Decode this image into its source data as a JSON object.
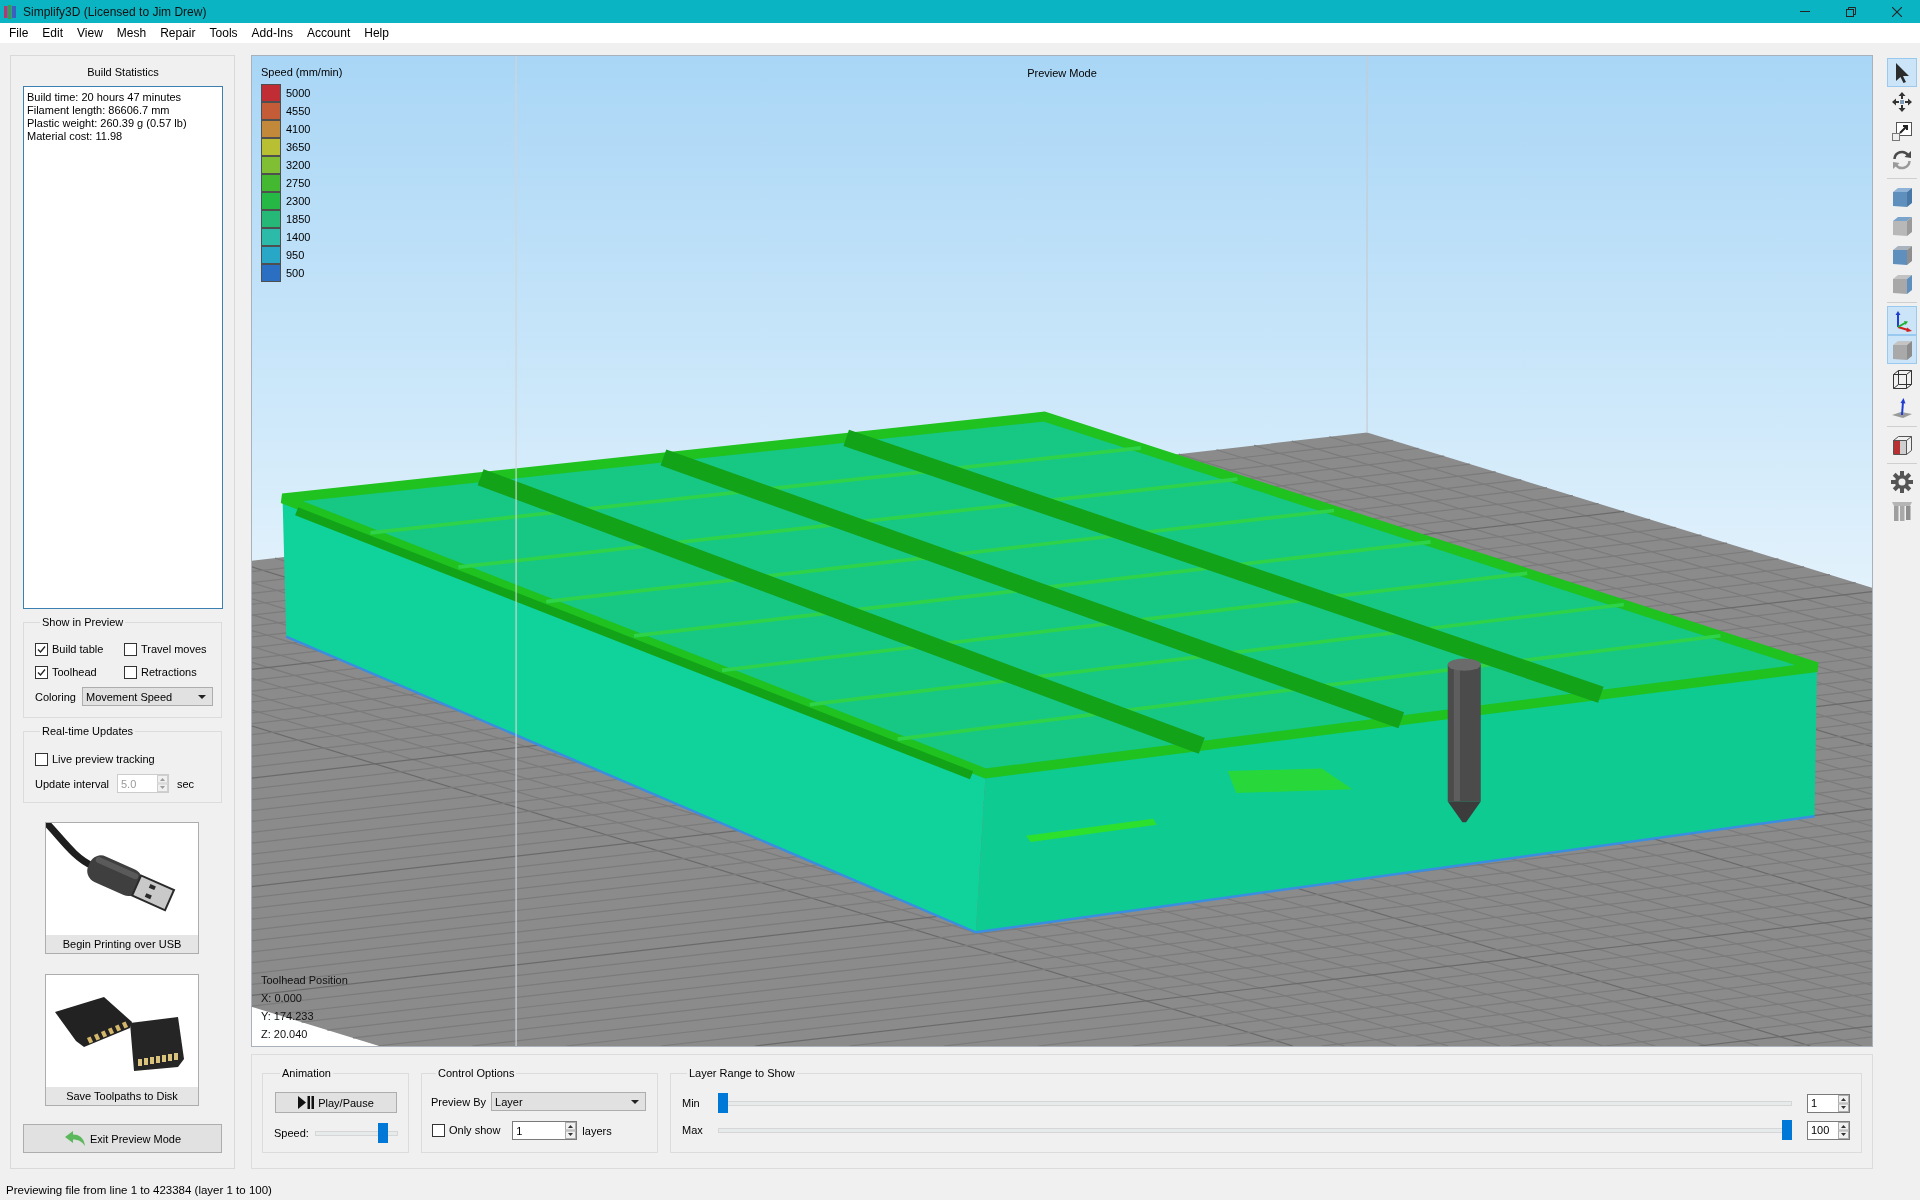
{
  "window": {
    "title": "Simplify3D (Licensed to Jim Drew)"
  },
  "menu": [
    "File",
    "Edit",
    "View",
    "Mesh",
    "Repair",
    "Tools",
    "Add-Ins",
    "Account",
    "Help"
  ],
  "build_statistics": {
    "title": "Build Statistics",
    "lines": [
      "Build time: 20 hours 47 minutes",
      "Filament length: 86606.7 mm",
      "Plastic weight: 260.39 g (0.57 lb)",
      "Material cost: 11.98"
    ]
  },
  "show_in_preview": {
    "title": "Show in Preview",
    "checkboxes": [
      {
        "label": "Build table",
        "checked": true
      },
      {
        "label": "Travel moves",
        "checked": false
      },
      {
        "label": "Toolhead",
        "checked": true
      },
      {
        "label": "Retractions",
        "checked": false
      }
    ],
    "coloring": {
      "label": "Coloring",
      "value": "Movement Speed"
    }
  },
  "realtime_updates": {
    "title": "Real-time Updates",
    "live_tracking": {
      "label": "Live preview tracking",
      "checked": false
    },
    "update_interval": {
      "label": "Update interval",
      "value": "5.0",
      "unit": "sec",
      "disabled": true
    }
  },
  "output_buttons": [
    {
      "kind": "usb",
      "label": "Begin Printing over USB"
    },
    {
      "kind": "sd_card",
      "label": "Save Toolpaths to Disk"
    }
  ],
  "exit_button": {
    "label": "Exit Preview Mode"
  },
  "viewport": {
    "mode_label": "Preview Mode",
    "legend": {
      "title": "Speed (mm/min)",
      "items": [
        {
          "value": "5000",
          "color": "#c12d35"
        },
        {
          "value": "4550",
          "color": "#c45c38"
        },
        {
          "value": "4100",
          "color": "#c2893a"
        },
        {
          "value": "3650",
          "color": "#b8bf33"
        },
        {
          "value": "3200",
          "color": "#80be33"
        },
        {
          "value": "2750",
          "color": "#45b832"
        },
        {
          "value": "2300",
          "color": "#25b845"
        },
        {
          "value": "1850",
          "color": "#26b877"
        },
        {
          "value": "1400",
          "color": "#2bbba8"
        },
        {
          "value": "950",
          "color": "#28a7c6"
        },
        {
          "value": "500",
          "color": "#2b6fc2"
        }
      ]
    },
    "toolhead_position": {
      "title": "Toolhead Position",
      "lines": [
        "X: 0.000",
        "Y: 174.233",
        "Z: 20.040"
      ]
    }
  },
  "animation": {
    "title": "Animation",
    "play_button": {
      "label": "Play/Pause"
    },
    "speed": {
      "label": "Speed:",
      "level": 0.86
    }
  },
  "control_options": {
    "title": "Control Options",
    "preview_by": {
      "label": "Preview By",
      "value": "Layer"
    },
    "only_show": {
      "label": "Only show",
      "checked": false,
      "value": "1",
      "unit": "layers"
    }
  },
  "layer_range": {
    "title": "Layer Range to Show",
    "sliders": [
      {
        "label": "Min",
        "level": 0,
        "value": "1"
      },
      {
        "label": "Max",
        "level": 1,
        "value": "100"
      }
    ]
  },
  "right_toolbar": {
    "groups": [
      [
        {
          "kind": "select",
          "selected": true
        },
        {
          "kind": "move",
          "selected": false
        },
        {
          "kind": "scale",
          "selected": false
        },
        {
          "kind": "rotate",
          "selected": false
        }
      ],
      [
        {
          "kind": "view_iso",
          "selected": false
        },
        {
          "kind": "view_top",
          "selected": false
        },
        {
          "kind": "view_front",
          "selected": false
        },
        {
          "kind": "view_side",
          "selected": false
        }
      ],
      [
        {
          "kind": "axes",
          "selected": true
        },
        {
          "kind": "solid",
          "selected": true
        },
        {
          "kind": "wireframe",
          "selected": false
        },
        {
          "kind": "normals",
          "selected": false
        }
      ],
      [
        {
          "kind": "cross_section",
          "selected": false
        }
      ],
      [
        {
          "kind": "settings",
          "selected": false
        },
        {
          "kind": "supports",
          "selected": false
        }
      ]
    ]
  },
  "status_bar": {
    "text": "Previewing file from line 1 to 423384 (layer 1 to 100)"
  }
}
